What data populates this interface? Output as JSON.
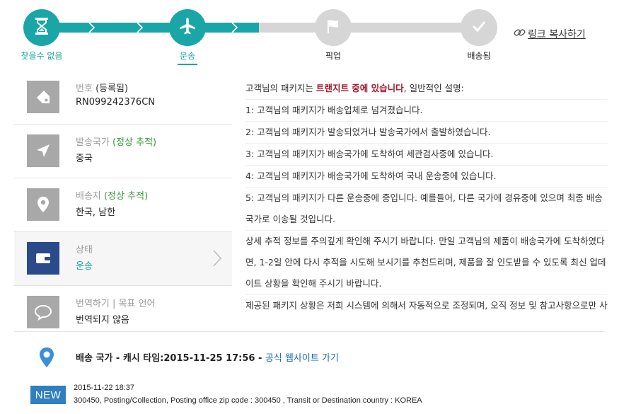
{
  "progress": {
    "steps": [
      {
        "label": "찾을수 없음",
        "state": "done",
        "icon": "hourglass-icon"
      },
      {
        "label": "운송",
        "state": "current",
        "icon": "airplane-icon"
      },
      {
        "label": "픽업",
        "state": "pending",
        "icon": "flag-icon"
      },
      {
        "label": "배송됨",
        "state": "pending",
        "icon": "check-icon"
      }
    ],
    "copy_link": "링크 복사하기",
    "colors": {
      "active": "#1aa6a6",
      "inactive": "#d6d6d6"
    }
  },
  "info": {
    "number": {
      "title": "번호",
      "status": "(등록됨)",
      "value": "RN099242376CN",
      "icon": "tag-icon"
    },
    "origin": {
      "title": "발송국가",
      "status": "(정상 추적)",
      "value": "중국",
      "icon": "send-icon"
    },
    "destination": {
      "title": "배송지",
      "status": "(정상 추적)",
      "value": "한국, 남한",
      "icon": "location-pin-icon"
    },
    "state": {
      "title": "상태",
      "value": "운송",
      "icon": "wallet-icon"
    },
    "translate": {
      "title": "번역하기 | 목표 언어",
      "value": "번역되지 않음",
      "icon": "speech-bubble-icon"
    }
  },
  "description": {
    "intro_before": "고객님의 패키지는 ",
    "intro_highlight": "트랜지트 중에 있습니다",
    "intro_after": ", 일반적인 설명:",
    "items": [
      "1: 고객님의 패키지가 배송업체로 넘겨졌습니다.",
      "2: 고객님의 패키지가 발송되었거나 발송국가에서 출발하였습니다.",
      "3: 고객님의 패키지가 배송국가에 도착하여 세관검사중에 있습니다.",
      "4: 고객님의 패키지가 배송국가에 도착하여 국내 운송중에 있습니다.",
      "5: 고객님의 패키지가 다른 운송중에 중입니다. 예를들어, 다른 국가에 경유중에 있으며 최종 배송국가로 이송될 것입니다."
    ],
    "paragraph1": "상세 추적 정보를 주의깊게 확인해 주시기 바랍니다. 만일 고객님의 제품이 배송국가에 도착하였다면, 1-2일 안에 다시 추적을 시도해 보시기를 추천드리며, 제품을 잘 인도받을 수 있도록 최신 업데이트 상황을 확인해 주시기 바랍니다.",
    "paragraph2": "제공된 패키지 상황은 저희 시스템에 의해서 자동적으로 조정되며, 오직 정보 및 참고사항으로만 사용할 수 있습니다. 만일 저희 시스템에서 고객님에게 부정확한 배송정보를 제공하면 더 정확한 추적정보를 제공하기 위해서 만석이지 마시고"
  },
  "tracking": {
    "cache_label": "배송 국가 - 캐시 타임:",
    "cache_time": "2015-11-25 17:56",
    "separator": " - ",
    "official_link": "공식 웹사이트 가기",
    "badge": "NEW",
    "event_time": "2015-11-22 18:37",
    "event_desc": "300450, Posting/Collection, Posting office zip code : 300450 , Transit or Destination country : KOREA"
  }
}
